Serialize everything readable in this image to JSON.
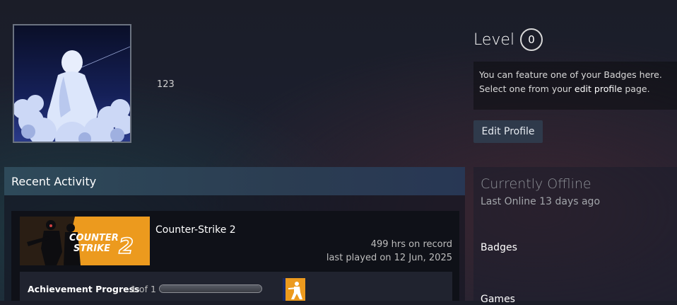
{
  "profile": {
    "username": "123"
  },
  "level": {
    "label": "Level",
    "value": "0"
  },
  "badge_showcase": {
    "line1": "You can feature one of your Badges here.",
    "line2_prefix": "Select one from your ",
    "line2_link": "edit profile",
    "line2_suffix": " page."
  },
  "edit_profile_button": "Edit Profile",
  "recent_activity": {
    "header": "Recent Activity",
    "game": {
      "name": "Counter-Strike 2",
      "capsule_line1": "COUNTER",
      "capsule_line2": "STRIKE",
      "capsule_number": "2",
      "hours": "499 hrs on record",
      "last_played": "last played on 12 Jun, 2025",
      "achievement_label": "Achievement Progress",
      "achievement_count": "1 of 1",
      "achievement_progress": 1.0
    }
  },
  "status": {
    "title": "Currently Offline",
    "last_online": "Last Online 13 days ago"
  },
  "nav": {
    "badges": "Badges",
    "games": "Games"
  },
  "colors": {
    "cs2_orange": "#ec9a1e",
    "button_bg": "#2f3a4b"
  }
}
